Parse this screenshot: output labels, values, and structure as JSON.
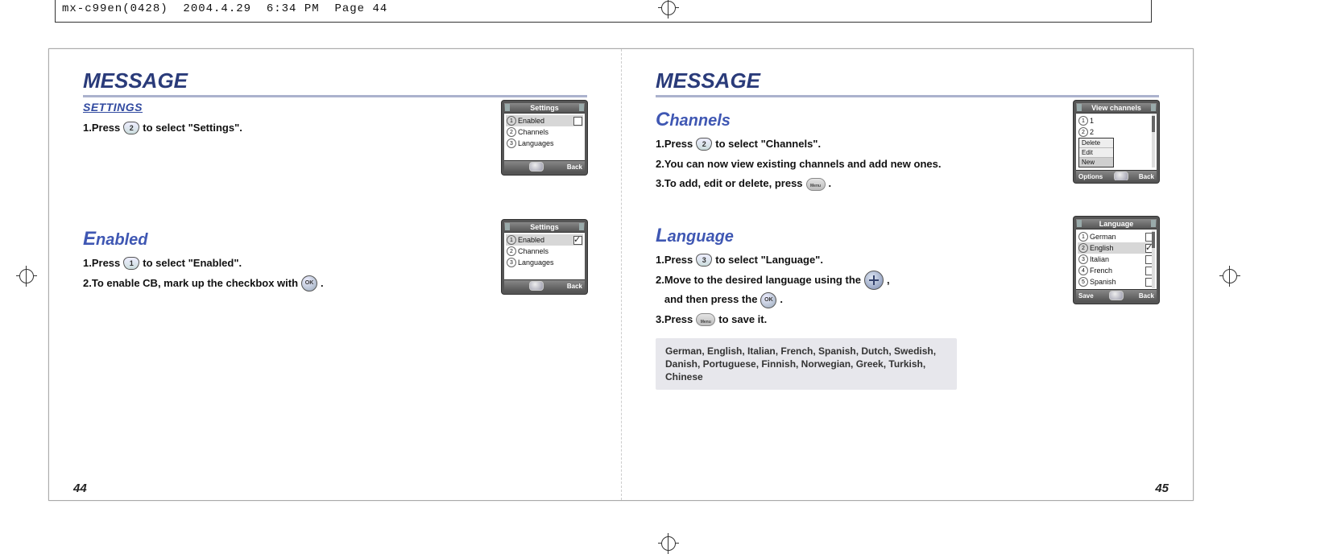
{
  "slug": "mx-c99en(0428)  2004.4.29  6:34 PM  Page 44",
  "left_page": {
    "heading": "MESSAGE",
    "settings": {
      "title": "SETTINGS",
      "steps": {
        "s1a": "1.Press ",
        "s1b": " to select \"Settings\"."
      },
      "key2": "2",
      "phone": {
        "title": "Settings",
        "items": [
          "Enabled",
          "Channels",
          "Languages"
        ],
        "foot_left": "",
        "foot_right": "Back"
      }
    },
    "enabled": {
      "title_drop": "E",
      "title_rest": "nabled",
      "s1a": "1.Press ",
      "s1b": " to select \"Enabled\".",
      "key1": "1",
      "s2a": "2.To enable CB, mark up the checkbox with ",
      "s2b": " .",
      "keyOK": "OK",
      "phone": {
        "title": "Settings",
        "items": [
          "Enabled",
          "Channels",
          "Languages"
        ],
        "foot_left": "",
        "foot_right": "Back"
      }
    },
    "pagenum": "44"
  },
  "right_page": {
    "heading": "MESSAGE",
    "channels": {
      "title_drop": "C",
      "title_rest": "hannels",
      "s1a": "1.Press ",
      "s1b": " to select \"Channels\".",
      "key2": "2",
      "s2": "2.You can now view existing channels and add new ones.",
      "s3a": "3.To add, edit or delete, press ",
      "s3b": " .",
      "phone": {
        "title": "View channels",
        "items": [
          "1",
          "2"
        ],
        "ctx": [
          "Delete",
          "Edit",
          "New"
        ],
        "foot_left": "Options",
        "foot_right": "Back"
      }
    },
    "language": {
      "title_drop": "L",
      "title_rest": "anguage",
      "s1a": "1.Press ",
      "s1b": " to select \"Language\".",
      "key3": "3",
      "s2a": "2.Move to the desired language using the ",
      "s2b": " ,",
      "s2c": "and then press the ",
      "s2d": " .",
      "keyOK": "OK",
      "s3a": "3.Press ",
      "s3b": "to save it.",
      "note": "German, English, Italian, French, Spanish, Dutch, Swedish, Danish, Portuguese, Finnish, Norwegian, Greek, Turkish, Chinese",
      "phone": {
        "title": "Language",
        "items": [
          "German",
          "English",
          "Italian",
          "French",
          "Spanish"
        ],
        "checked_index": 1,
        "foot_left": "Save",
        "foot_right": "Back"
      }
    },
    "pagenum": "45"
  }
}
